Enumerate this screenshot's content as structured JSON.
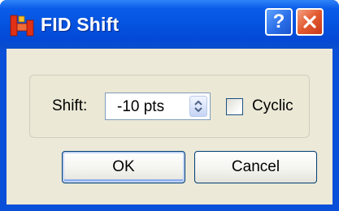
{
  "window": {
    "title": "FID Shift",
    "title_color": "#ffffff",
    "titlebar_color": "#0553e0"
  },
  "title_buttons": {
    "help_icon": "question-mark",
    "help_glyph": "?",
    "close_icon": "x-mark"
  },
  "form": {
    "shift_label": "Shift:",
    "shift_value": "-10 pts",
    "cyclic_label": "Cyclic",
    "cyclic_checked": false
  },
  "buttons": {
    "ok_label": "OK",
    "cancel_label": "Cancel"
  },
  "colors": {
    "dialog_background": "#ece9d8",
    "close_button": "#e2592f",
    "app_icon": "#e03016"
  }
}
